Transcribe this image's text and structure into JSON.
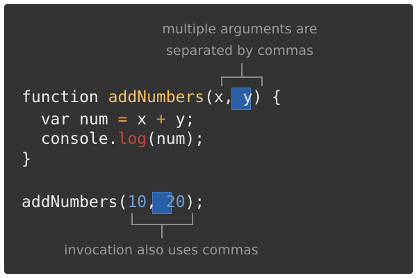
{
  "annotations": {
    "top_line1": "multiple arguments are",
    "top_line2": "separated by commas",
    "bottom": "invocation also uses commas"
  },
  "code": {
    "line1": {
      "kw": "function ",
      "name": "addNumbers",
      "open": "(x",
      "comma": ",",
      "rest": " y) {"
    },
    "line2": {
      "a": "  var num ",
      "eq": "=",
      "b": " x ",
      "plus": "+",
      "c": " y;"
    },
    "line3": {
      "a": "  console.",
      "method": "log",
      "b": "(num);"
    },
    "line4": "}",
    "line5": {
      "a": "addNumbers(",
      "n1": "10",
      "comma": ",",
      "sp": " ",
      "n2": "20",
      "b": ");"
    }
  },
  "colors": {
    "background": "#333333",
    "text": "#ececec",
    "function_name": "#f5c265",
    "operator": "#e89b3f",
    "method": "#c8473f",
    "number": "#6f9fd0",
    "highlight": "#2a5fa8",
    "annotation": "#9a9a9a"
  }
}
